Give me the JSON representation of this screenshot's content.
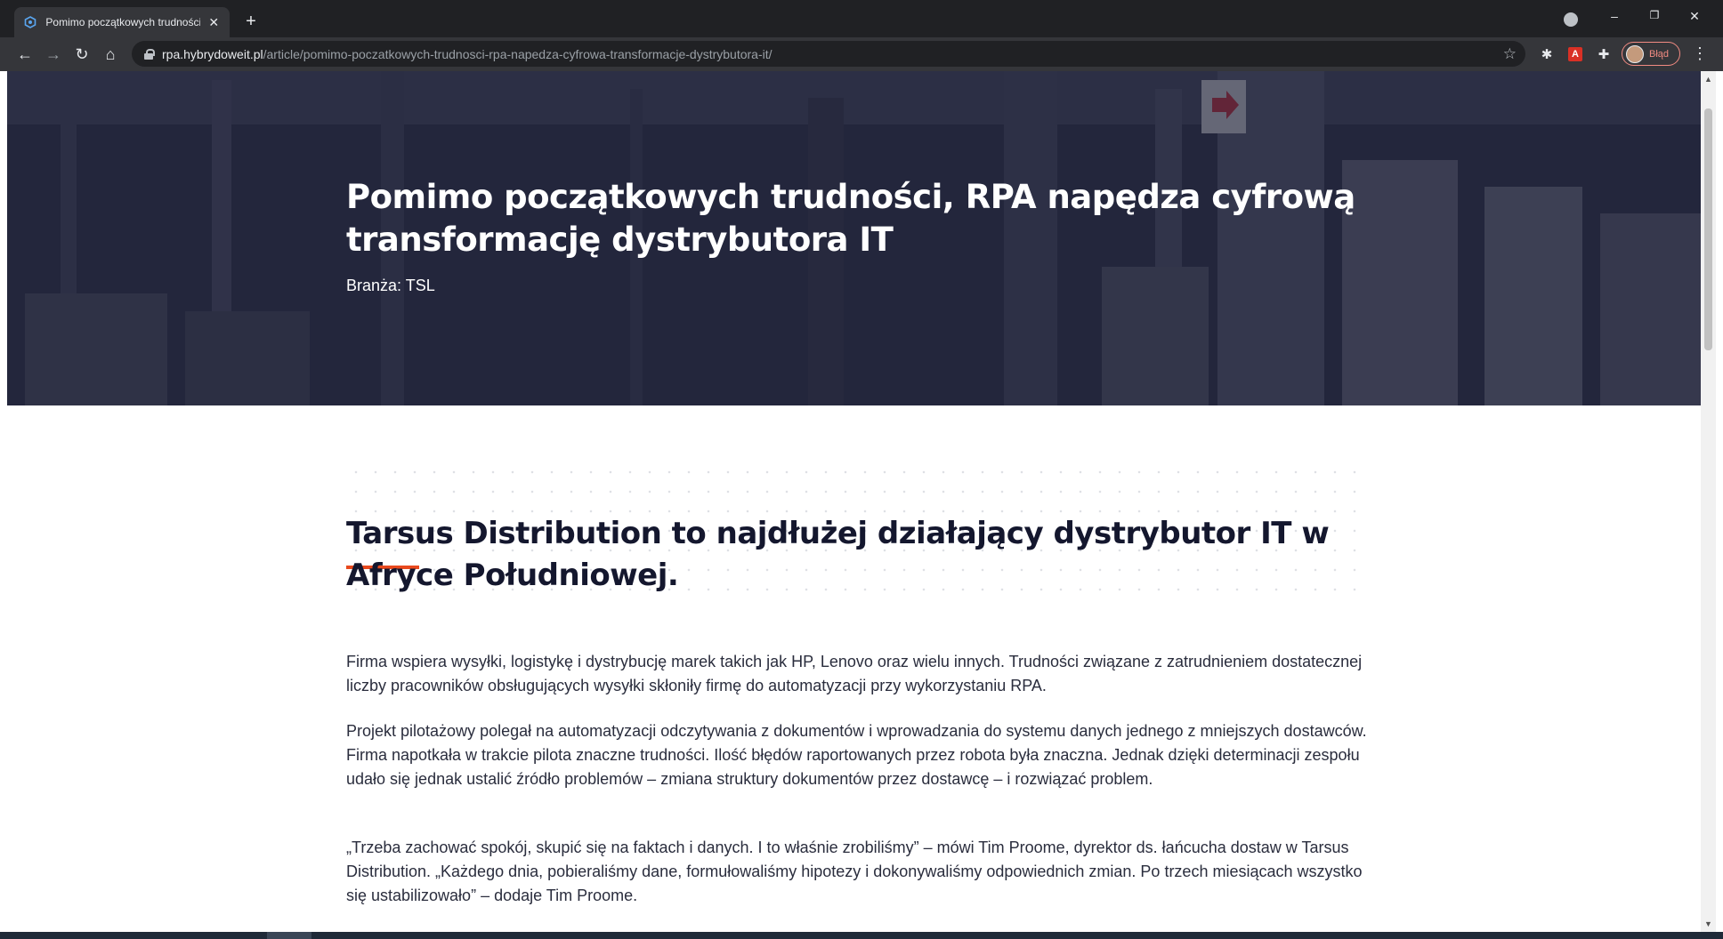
{
  "browser": {
    "tab_title": "Pomimo początkowych trudności, RPA napędza cyfrową transformację dystrybutora IT",
    "tab_close": "✕",
    "new_tab": "+",
    "url_host": "rpa.hybrydoweit.pl",
    "url_path": "/article/pomimo-poczatkowych-trudnosci-rpa-napedza-cyfrowa-transformacje-dystrybutora-it/",
    "profile_label": "Błąd",
    "window_controls": {
      "minimize": "–",
      "restore": "❐",
      "close": "✕"
    },
    "nav": {
      "back": "←",
      "forward": "→",
      "reload": "↻",
      "home": "⌂"
    },
    "icons": {
      "star": "☆",
      "menu": "⋮",
      "extension_settings": "✱",
      "extension_pdf": "A",
      "extension_puzzle": "✚"
    }
  },
  "hero": {
    "title": "Pomimo początkowych trudności, RPA napędza cyfrową transformację dystrybutora IT",
    "branch": "Branża: TSL"
  },
  "article": {
    "heading": "Tarsus Distribution to najdłużej działający dystrybutor IT w Afryce Południowej.",
    "paragraphs": [
      "Firma wspiera wysyłki, logistykę i dystrybucję marek takich jak HP, Lenovo oraz wielu innych. Trudności związane z zatrudnieniem dostatecznej liczby pracowników obsługujących wysyłki skłoniły firmę do automatyzacji przy wykorzystaniu RPA.",
      "Projekt pilotażowy polegał na automatyzacji odczytywania z dokumentów i wprowadzania do systemu danych jednego z mniejszych dostawców. Firma napotkała w trakcie pilota znaczne trudności. Ilość błędów raportowanych przez robota była znaczna. Jednak dzięki determinacji zespołu udało się jednak ustalić źródło problemów – zmiana struktury dokumentów przez dostawcę – i rozwiązać problem.",
      "„Trzeba zachować spokój, skupić się na faktach i danych. I to właśnie zrobiliśmy” – mówi Tim Proome, dyrektor ds. łańcucha dostaw w Tarsus Distribution. „Każdego dnia, pobieraliśmy dane, formułowaliśmy hipotezy i dokonywaliśmy odpowiednich zmian. Po trzech miesiącach wszystko się ustabilizowało” – dodaje Tim Proome."
    ]
  },
  "colors": {
    "accent": "#e8491d",
    "heading": "#14172e",
    "chrome": "#202124"
  }
}
